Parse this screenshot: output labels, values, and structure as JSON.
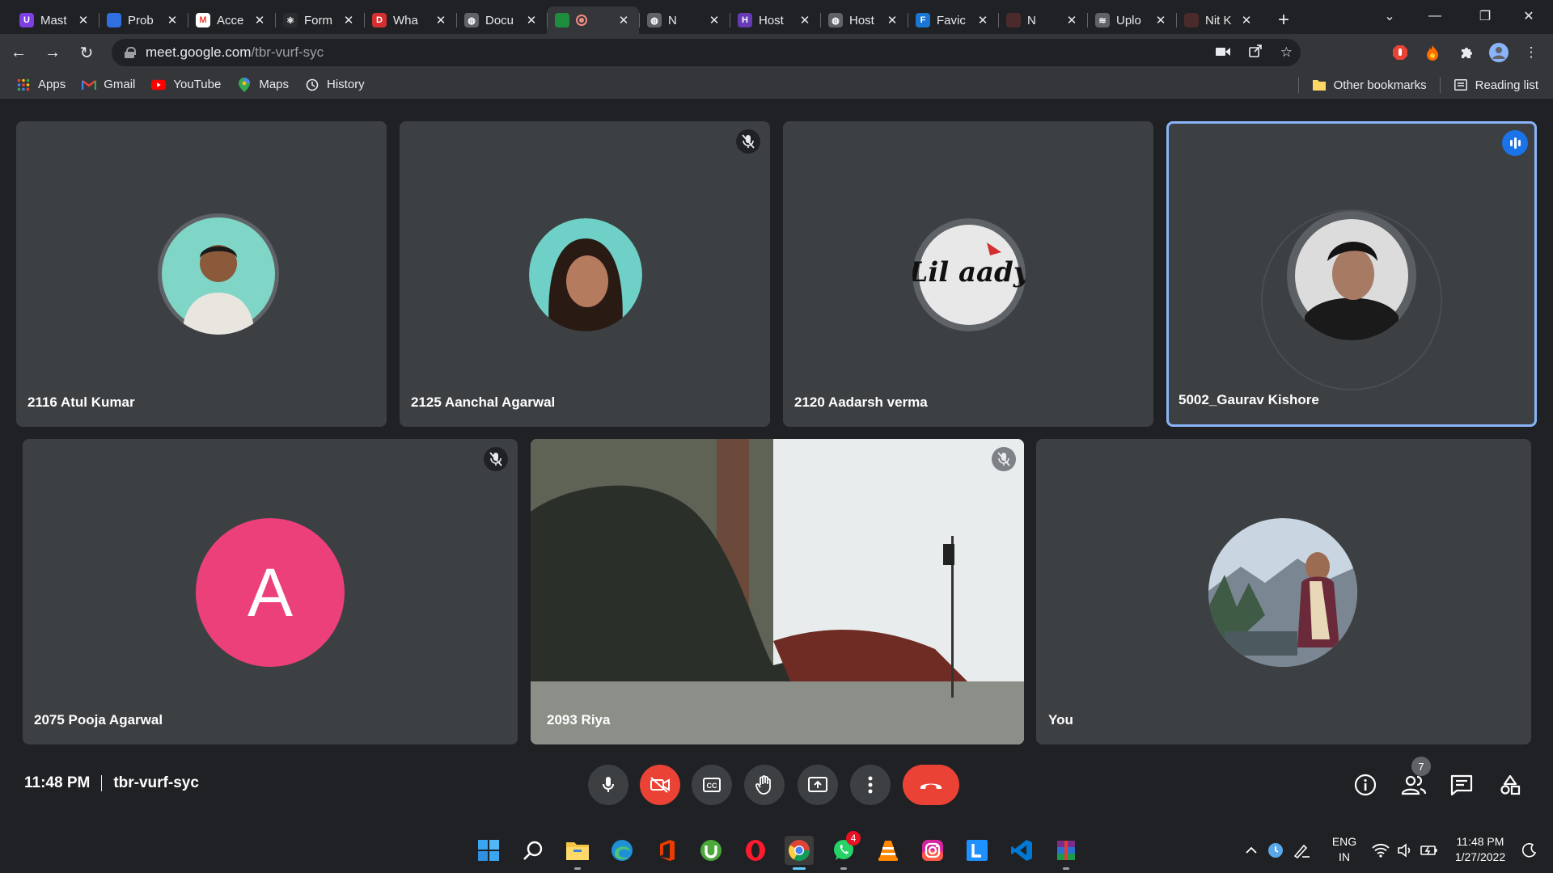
{
  "browser": {
    "tabs": [
      {
        "title": "Mast",
        "favicon_color": "#7b3fe4",
        "favicon_text": "U"
      },
      {
        "title": "Prob",
        "favicon_color": "#2f6fe0",
        "favicon_text": ""
      },
      {
        "title": "Acce",
        "favicon_color": "#ffffff",
        "favicon_text": "M"
      },
      {
        "title": "Form",
        "favicon_color": "#2a2b2e",
        "favicon_text": "⚛"
      },
      {
        "title": "Wha",
        "favicon_color": "#d32f2f",
        "favicon_text": "D"
      },
      {
        "title": "Docu",
        "favicon_color": "#5f6368",
        "favicon_text": "◍"
      },
      {
        "title": "",
        "favicon_color": "#1e8e3e",
        "favicon_text": "",
        "active": true
      },
      {
        "title": "N",
        "favicon_color": "#5f6368",
        "favicon_text": "◍"
      },
      {
        "title": "Host",
        "favicon_color": "#673ab7",
        "favicon_text": "H"
      },
      {
        "title": "Host",
        "favicon_color": "#5f6368",
        "favicon_text": "◍"
      },
      {
        "title": "Favic",
        "favicon_color": "#1976d2",
        "favicon_text": "F"
      },
      {
        "title": "N",
        "favicon_color": "#4a2a2a",
        "favicon_text": ""
      },
      {
        "title": "Uplo",
        "favicon_color": "#5f6368",
        "favicon_text": "≋"
      },
      {
        "title": "Nit K",
        "favicon_color": "#4a2a2a",
        "favicon_text": ""
      }
    ],
    "url_host": "meet.google.com",
    "url_path": "/tbr-vurf-syc",
    "bookmarks": {
      "apps": "Apps",
      "gmail": "Gmail",
      "youtube": "YouTube",
      "maps": "Maps",
      "history": "History",
      "other": "Other bookmarks",
      "reading_list": "Reading list"
    }
  },
  "meet": {
    "participants": [
      {
        "name": "2116 Atul Kumar",
        "muted": false,
        "avatar": "photo"
      },
      {
        "name": "2125 Aanchal Agarwal",
        "muted": true,
        "avatar": "photo"
      },
      {
        "name": "2120 Aadarsh verma",
        "muted": false,
        "avatar": "logo",
        "logo_text": "Lil aady"
      },
      {
        "name": "5002_Gaurav Kishore",
        "muted": false,
        "speaking": true,
        "avatar": "photo"
      },
      {
        "name": "2075 Pooja Agarwal",
        "muted": true,
        "avatar": "letter",
        "letter": "A",
        "avatar_color": "#ec407a"
      },
      {
        "name": "2093 Riya",
        "muted": true,
        "avatar": "video"
      },
      {
        "name": "You",
        "muted": false,
        "avatar": "photo"
      }
    ],
    "time": "11:48 PM",
    "meeting_code": "tbr-vurf-syc",
    "participant_count": "7",
    "colors": {
      "accent": "#8ab4f8",
      "danger": "#ea4335",
      "tile": "#3c4043"
    }
  },
  "taskbar": {
    "whatsapp_badge": "4",
    "language": "ENG",
    "region": "IN",
    "clock_time": "11:48 PM",
    "clock_date": "1/27/2022"
  }
}
